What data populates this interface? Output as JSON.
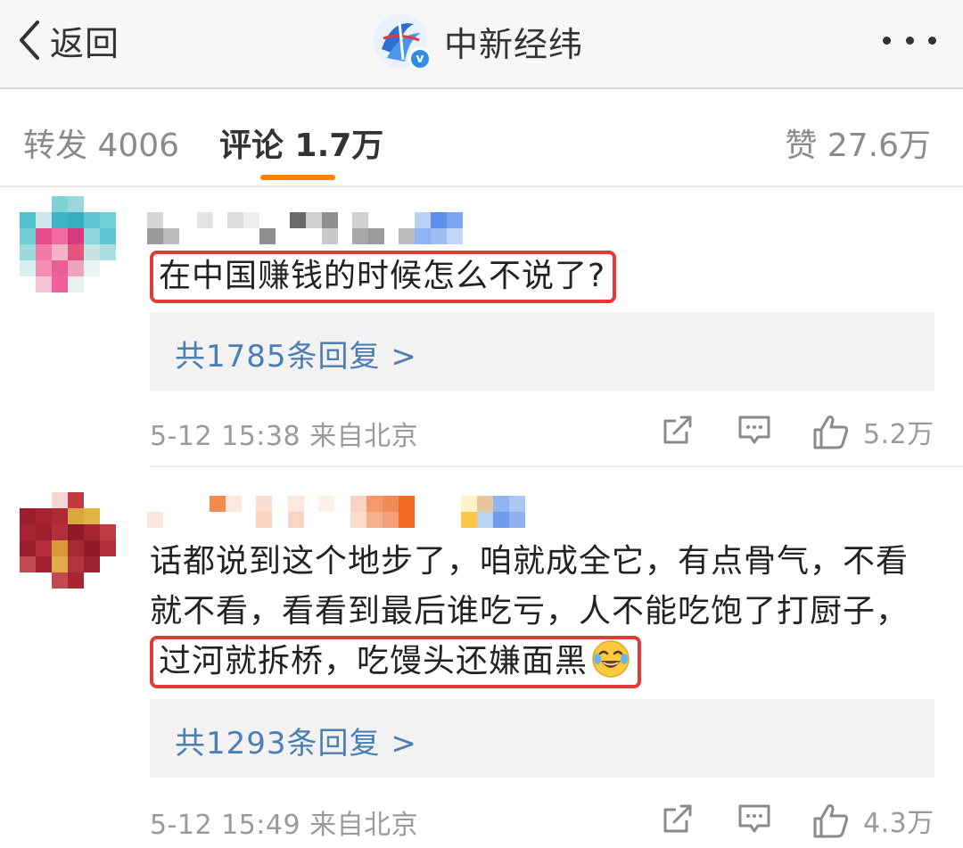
{
  "nav": {
    "back_label": "返回",
    "title": "中新经纬",
    "verified_badge": "v"
  },
  "tabs": {
    "repost": "转发 4006",
    "comment": "评论 1.7万",
    "like": "赞 27.6万",
    "active": "comment",
    "accent_color": "#ff8200"
  },
  "comments": [
    {
      "text": "在中国赚钱的时候怎么不说了?",
      "highlighted": "在中国赚钱的时候怎么不说了?",
      "replies": "共1785条回复 >",
      "meta": "5-12 15:38  来自北京",
      "likes": "5.2万"
    },
    {
      "text_before": "话都说到这个地步了，咱就成全它，有点骨气，不看就不看，看看到最后谁吃亏，人不能吃饱了打厨子，",
      "highlighted": "过河就拆桥，吃馒头还嫌面黑",
      "emoji": "laugh-cry-emoji",
      "replies": "共1293条回复 >",
      "meta": "5-12 15:49  来自北京",
      "likes": "4.3万"
    }
  ],
  "colors": {
    "highlight_border": "#e53935",
    "link_blue": "#4a7eb5",
    "meta_gray": "#9a9a9a",
    "reply_bg": "#f2f2f2"
  },
  "icons": [
    "chevron-left-icon",
    "logo-icon",
    "verified-icon",
    "more-icon",
    "share-icon",
    "reply-icon",
    "like-icon"
  ]
}
